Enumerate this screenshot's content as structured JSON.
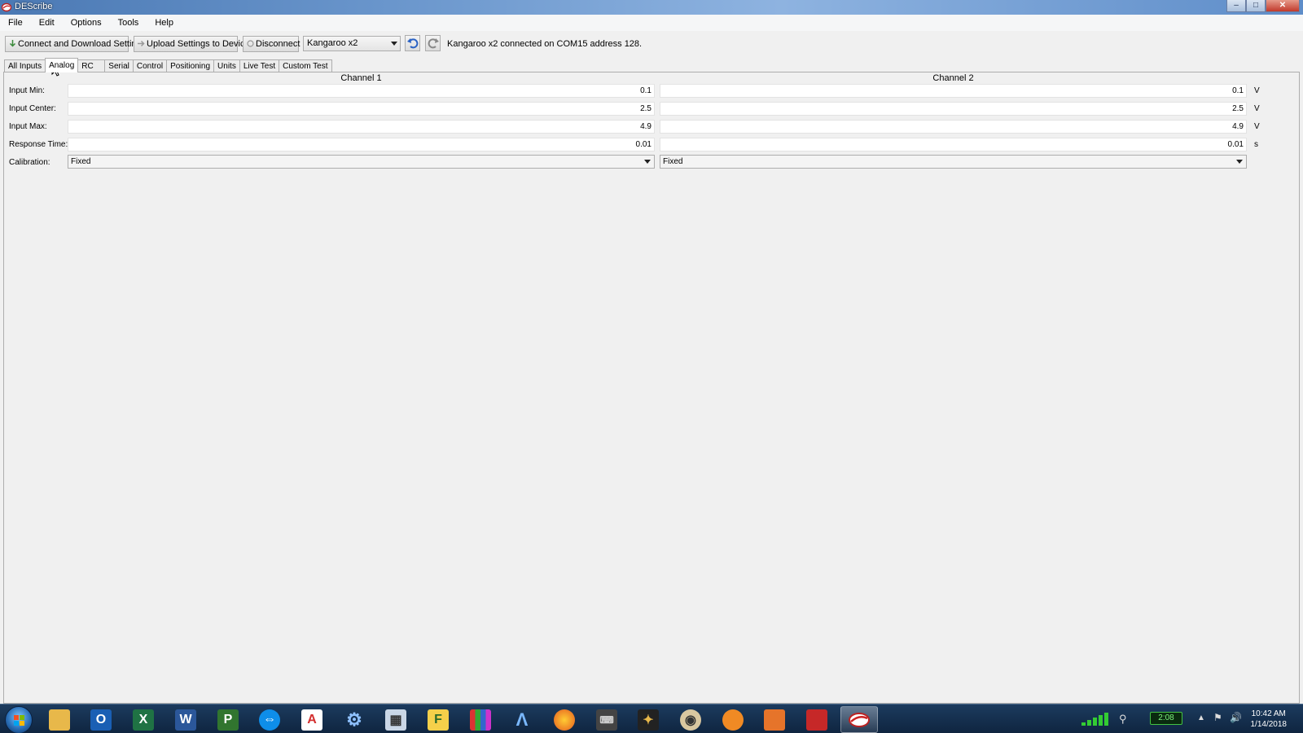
{
  "window": {
    "title": "DEScribe"
  },
  "menu": [
    "File",
    "Edit",
    "Options",
    "Tools",
    "Help"
  ],
  "toolbar": {
    "connect_label": "Connect and Download Settings",
    "upload_label": "Upload Settings to Device",
    "disconnect_label": "Disconnect",
    "device_selected": "Kangaroo x2",
    "status": "Kangaroo x2 connected on COM15 address 128."
  },
  "tabs": [
    {
      "label": "All Inputs",
      "active": false
    },
    {
      "label": "Analog",
      "active": true
    },
    {
      "label": "RC",
      "active": false
    },
    {
      "label": "Serial",
      "active": false
    },
    {
      "label": "Control",
      "active": false
    },
    {
      "label": "Positioning",
      "active": false
    },
    {
      "label": "Units",
      "active": false
    },
    {
      "label": "Live Test",
      "active": false
    },
    {
      "label": "Custom Test",
      "active": false
    }
  ],
  "channels": [
    "Channel 1",
    "Channel 2"
  ],
  "rows": [
    {
      "label": "Input Min:",
      "ch1": "0.1",
      "ch2": "0.1",
      "unit": "V"
    },
    {
      "label": "Input Center:",
      "ch1": "2.5",
      "ch2": "2.5",
      "unit": "V"
    },
    {
      "label": "Input Max:",
      "ch1": "4.9",
      "ch2": "4.9",
      "unit": "V"
    },
    {
      "label": "Response Time:",
      "ch1": "0.01",
      "ch2": "0.01",
      "unit": "s"
    }
  ],
  "calibration": {
    "label": "Calibration:",
    "ch1": "Fixed",
    "ch2": "Fixed"
  },
  "taskbar": {
    "battery": "2:08",
    "time": "10:42 AM",
    "date": "1/14/2018",
    "apps": [
      "explorer-icon",
      "outlook-icon",
      "excel-icon",
      "word-icon",
      "project-icon",
      "teamviewer-icon",
      "acrobat-icon",
      "settings-icon",
      "calculator-icon",
      "f-app-icon",
      "bars-app-icon",
      "arduino-icon",
      "firefox-icon",
      "keyboard-icon",
      "hammer-icon",
      "mixer-icon",
      "blender-icon",
      "matlab-icon",
      "toolbox-icon",
      "describe-icon"
    ]
  },
  "colors": {
    "titlebar": "#4b79b4",
    "taskbar": "#1c3b5e",
    "accent": "#2a6fb8"
  }
}
